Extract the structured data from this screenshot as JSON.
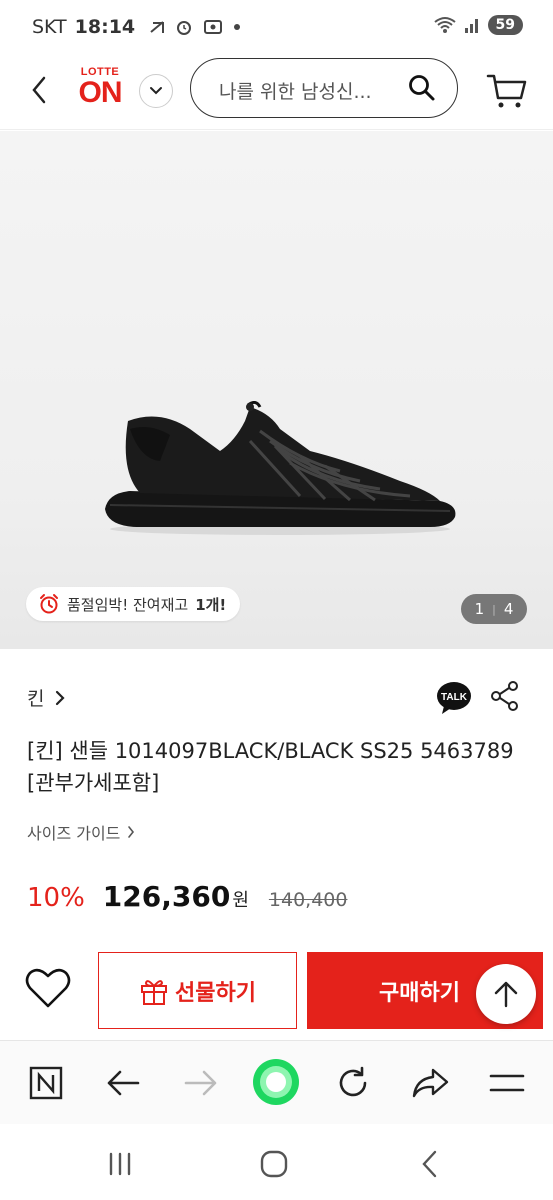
{
  "status_bar": {
    "carrier": "SKT",
    "time": "18:14",
    "battery": "59"
  },
  "header": {
    "logo_top": "LOTTE",
    "logo_main": "ON",
    "search_placeholder": "나를 위한 남성신..."
  },
  "gallery": {
    "stock_badge_prefix": "품절임박! 잔여재고 ",
    "stock_badge_count": "1개!",
    "page_current": "1",
    "page_separator": "|",
    "page_total": "4"
  },
  "product": {
    "brand": "킨",
    "title": "[킨] 샌들 1014097BLACK/BLACK SS25 5463789 [관부가세포함]",
    "size_guide": "사이즈 가이드",
    "talk_label": "TALK"
  },
  "price": {
    "discount": "10%",
    "sale_price": "126,360",
    "currency": "원",
    "original_price": "140,400"
  },
  "actions": {
    "gift_label": "선물하기",
    "buy_label": "구매하기"
  },
  "browser_bar": {
    "items": [
      "naver-home-icon",
      "back-arrow-icon",
      "forward-arrow-icon",
      "green-dot-icon",
      "refresh-icon",
      "share-icon",
      "menu-icon"
    ]
  },
  "colors": {
    "brand_red": "#e4221b",
    "green_accent": "#1ed760"
  }
}
